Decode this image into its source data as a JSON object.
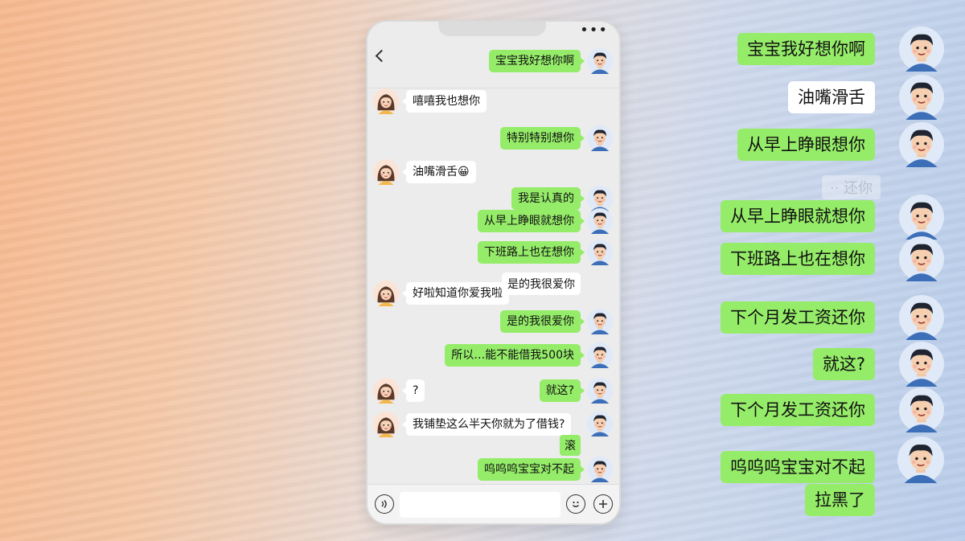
{
  "phone": {
    "menu_label": "•••",
    "messages": [
      {
        "side": "out",
        "text": "宝宝我好想你啊"
      },
      {
        "side": "in",
        "text": "嘻嘻我也想你"
      },
      {
        "side": "out",
        "text": "特别特别想你"
      },
      {
        "side": "in",
        "text": "油嘴滑舌😀"
      },
      {
        "side": "out",
        "text": "我是认真的"
      },
      {
        "side": "out",
        "text": "从早上睁眼就想你"
      },
      {
        "side": "out",
        "text": "下班路上也在想你"
      },
      {
        "side": "in",
        "text": "好啦知道你爱我啦"
      },
      {
        "side": "out",
        "text": "是的我很爱你"
      },
      {
        "side": "out",
        "text": "所以…能不能借我500块"
      },
      {
        "side": "in",
        "text": "?"
      },
      {
        "side": "out",
        "text": "就这?"
      },
      {
        "side": "in",
        "text": "我铺垫这么半天你就为了借钱?"
      },
      {
        "side": "out",
        "text": "呜呜呜宝宝对不起"
      }
    ],
    "overlap_text": "是的我很爱你",
    "small_reply": "滚",
    "input_placeholder": ""
  },
  "panel": {
    "ghost_text": "·· 还你",
    "messages": [
      {
        "style": "green",
        "text": "宝宝我好想你啊"
      },
      {
        "style": "white",
        "text": "油嘴滑舌"
      },
      {
        "style": "green",
        "text": "从早上睁眼想你"
      },
      {
        "style": "green",
        "text": "从早上睁眼就想你"
      },
      {
        "style": "green",
        "text": "下班路上也在想你"
      },
      {
        "style": "green",
        "text": "下个月发工资还你"
      },
      {
        "style": "green",
        "text": "就这?"
      },
      {
        "style": "green",
        "text": "下个月发工资还你"
      },
      {
        "style": "green",
        "text": "呜呜呜宝宝对不起"
      },
      {
        "style": "green",
        "text": "拉黑了"
      }
    ]
  },
  "icons": {
    "back": "chevron-left-icon",
    "menu": "more-dots-icon",
    "voice": "voice-icon",
    "emoji": "emoji-icon",
    "add": "plus-icon"
  },
  "colors": {
    "bubble_green": "#95ec69",
    "bubble_white": "#ffffff",
    "chat_bg": "#ececec",
    "bg_warm": "#f6b98f",
    "bg_cool": "#b9cdea"
  }
}
